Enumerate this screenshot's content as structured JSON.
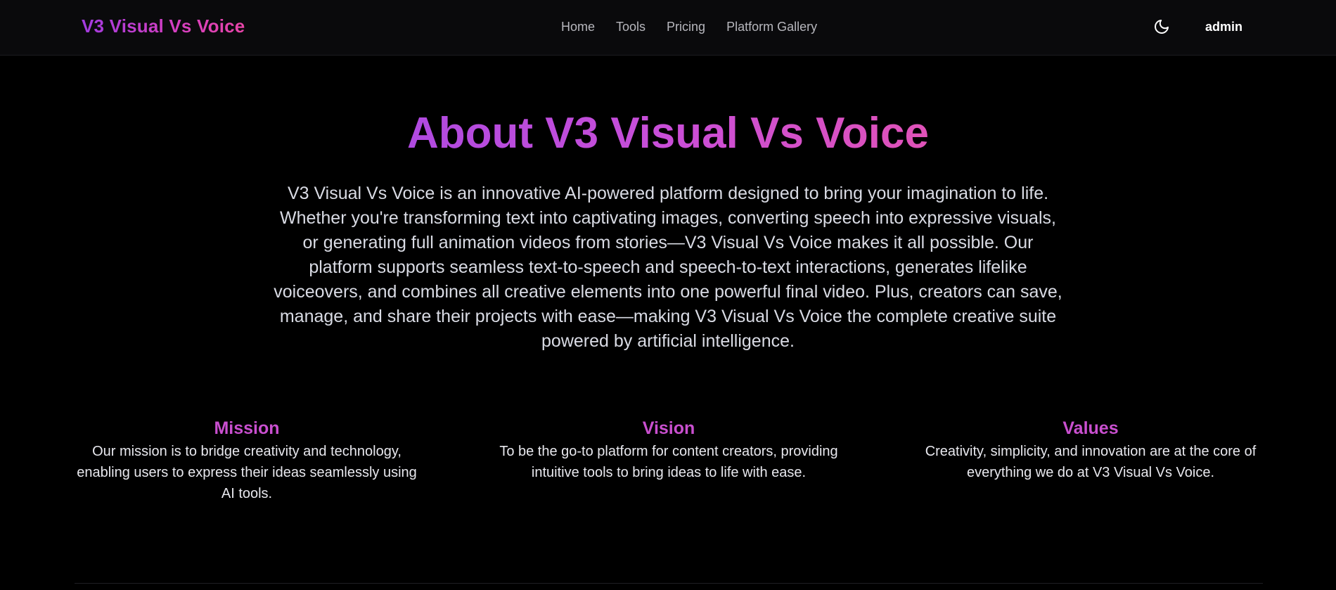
{
  "navbar": {
    "brand": "V3 Visual Vs Voice",
    "links": [
      "Home",
      "Tools",
      "Pricing",
      "Platform Gallery"
    ],
    "theme_toggle_icon": "moon-icon",
    "user": "admin"
  },
  "about": {
    "title": "About V3 Visual Vs Voice",
    "description": "V3 Visual Vs Voice is an innovative AI-powered platform designed to bring your imagination to life. Whether you're transforming text into captivating images, converting speech into expressive visuals, or generating full animation videos from stories—V3 Visual Vs Voice makes it all possible. Our platform supports seamless text-to-speech and speech-to-text interactions, generates lifelike voiceovers, and combines all creative elements into one powerful final video. Plus, creators can save, manage, and share their projects with ease—making V3 Visual Vs Voice the complete creative suite powered by artificial intelligence."
  },
  "values": [
    {
      "title": "Mission",
      "text": "Our mission is to bridge creativity and technology, enabling users to express their ideas seamlessly using AI tools."
    },
    {
      "title": "Vision",
      "text": "To be the go-to platform for content creators, providing intuitive tools to bring ideas to life with ease."
    },
    {
      "title": "Values",
      "text": "Creativity, simplicity, and innovation are at the core of everything we do at V3 Visual Vs Voice."
    }
  ],
  "colors": {
    "brand_gradient_start": "#a23be0",
    "brand_gradient_end": "#e845a8",
    "heading_accent": "#c94fcf",
    "background": "#000000",
    "navbar_background": "#0a0a0c"
  }
}
